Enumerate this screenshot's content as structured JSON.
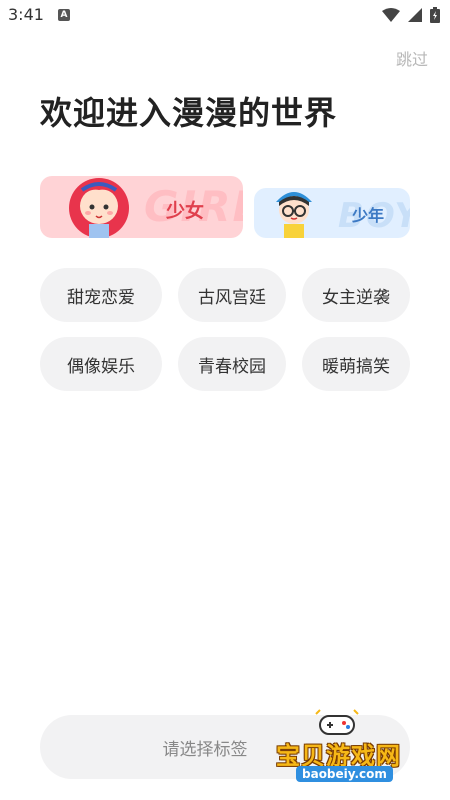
{
  "status_bar": {
    "time": "3:41",
    "notification_letter": "A"
  },
  "header": {
    "skip_label": "跳过",
    "title": "欢迎进入漫漫的世界"
  },
  "gender": {
    "girl": {
      "label": "少女",
      "watermark": "GIRL"
    },
    "boy": {
      "label": "少年",
      "watermark": "BOY"
    }
  },
  "tags": [
    "甜宠恋爱",
    "古风宫廷",
    "女主逆袭",
    "偶像娱乐",
    "青春校园",
    "暖萌搞笑"
  ],
  "bottom": {
    "prompt": "请选择标签"
  },
  "watermark_logo": {
    "text": "宝贝游戏网",
    "url": "baobeiy.com"
  },
  "colors": {
    "girl_card": "#ffd3d6",
    "boy_card": "#e1efff",
    "girl_accent": "#e0404d",
    "boy_accent": "#3c79c4",
    "tag_bg": "#f2f2f3"
  }
}
